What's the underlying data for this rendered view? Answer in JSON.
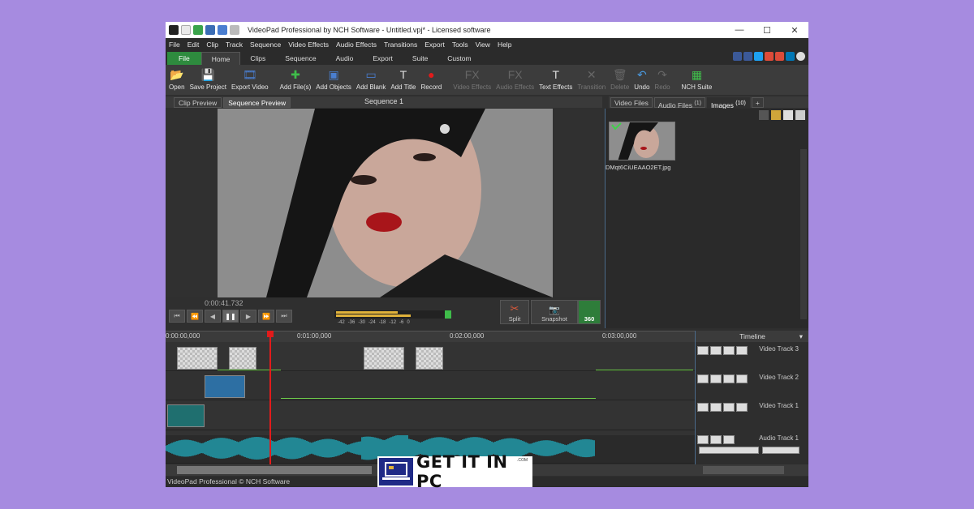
{
  "window": {
    "title": "VideoPad Professional by NCH Software - Untitled.vpj* - Licensed software",
    "controls": [
      "—",
      "☐",
      "✕"
    ]
  },
  "menu": [
    "File",
    "Edit",
    "Clip",
    "Track",
    "Sequence",
    "Video Effects",
    "Audio Effects",
    "Transitions",
    "Export",
    "Tools",
    "View",
    "Help"
  ],
  "ribbon_tabs": [
    "File",
    "Home",
    "Clips",
    "Sequence",
    "Audio",
    "Export",
    "Suite",
    "Custom"
  ],
  "toolbar": [
    {
      "label": "Open",
      "icon": "folder-open-icon",
      "glyph": "📂",
      "enabled": true
    },
    {
      "label": "Save Project",
      "icon": "save-icon",
      "glyph": "💾",
      "enabled": true
    },
    {
      "label": "Export Video",
      "icon": "export-icon",
      "glyph": "🎞",
      "enabled": true
    },
    {
      "label": "Add File(s)",
      "icon": "add-files-icon",
      "glyph": "✚",
      "enabled": true
    },
    {
      "label": "Add Objects",
      "icon": "add-objects-icon",
      "glyph": "▣",
      "enabled": true
    },
    {
      "label": "Add Blank",
      "icon": "add-blank-icon",
      "glyph": "▭",
      "enabled": true
    },
    {
      "label": "Add Title",
      "icon": "add-title-icon",
      "glyph": "T",
      "enabled": true
    },
    {
      "label": "Record",
      "icon": "record-icon",
      "glyph": "●",
      "enabled": true
    },
    {
      "label": "Video Effects",
      "icon": "video-effects-icon",
      "glyph": "FX",
      "enabled": false
    },
    {
      "label": "Audio Effects",
      "icon": "audio-effects-icon",
      "glyph": "FX",
      "enabled": false
    },
    {
      "label": "Text Effects",
      "icon": "text-effects-icon",
      "glyph": "T",
      "enabled": true
    },
    {
      "label": "Transition",
      "icon": "transition-icon",
      "glyph": "✕",
      "enabled": false
    },
    {
      "label": "Delete",
      "icon": "delete-icon",
      "glyph": "🗑",
      "enabled": false
    },
    {
      "label": "Undo",
      "icon": "undo-icon",
      "glyph": "↶",
      "enabled": true
    },
    {
      "label": "Redo",
      "icon": "redo-icon",
      "glyph": "↷",
      "enabled": false
    },
    {
      "label": "NCH Suite",
      "icon": "nch-suite-icon",
      "glyph": "▦",
      "enabled": true
    }
  ],
  "preview": {
    "tabs": [
      "Clip Preview",
      "Sequence Preview"
    ],
    "sequence_title": "Sequence 1",
    "timecode": "0:00:41.732",
    "meter_labels": [
      "-42",
      "-36",
      "-30",
      "-24",
      "-18",
      "-12",
      "-6",
      "0"
    ],
    "split_label": "Split",
    "snapshot_label": "Snapshot",
    "vr_label": "360"
  },
  "bin": {
    "tabs": [
      {
        "label": "Video Files",
        "count": ""
      },
      {
        "label": "Audio Files",
        "count": "(1)"
      },
      {
        "label": "Images",
        "count": "(10)"
      }
    ],
    "add_tab": "+",
    "item_name": "DMqt6CiUEAAO2ET.jpg"
  },
  "timeline": {
    "ruler": [
      "0:00:00,000",
      "0:01:00,000",
      "0:02:00,000",
      "0:03:00,000"
    ],
    "panel_title": "Timeline",
    "tracks": [
      "Video Track 3",
      "Video Track 2",
      "Video Track 1",
      "Audio Track 1"
    ]
  },
  "status": "VideoPad Professional © NCH Software",
  "badge": {
    "text": "GET IT IN PC",
    "com": ".COM"
  }
}
